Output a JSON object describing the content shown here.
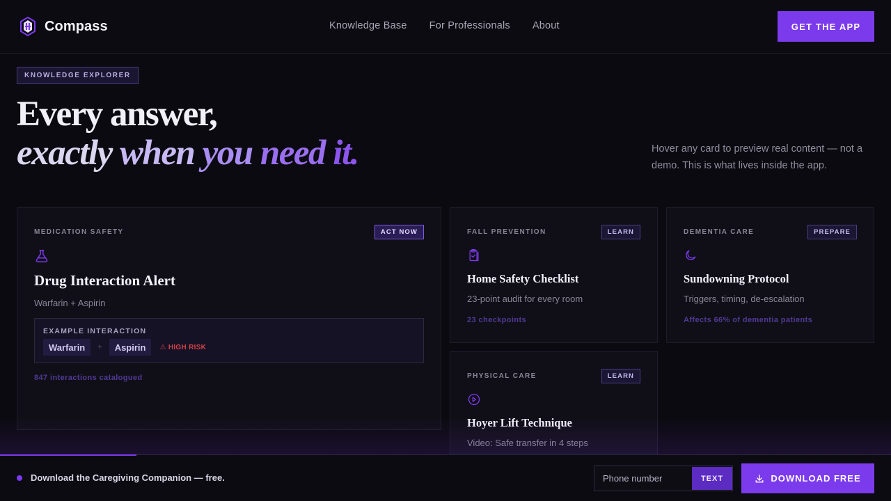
{
  "header": {
    "logo_text": "Compass",
    "nav": [
      "Knowledge Base",
      "For Professionals",
      "About"
    ],
    "cta_label": "GET THE APP"
  },
  "hero": {
    "badge": "KNOWLEDGE EXPLORER",
    "title_line1": "Every answer,",
    "title_line2_words": [
      "exactly",
      "when",
      "you",
      "need",
      "it."
    ],
    "description": "Hover any card to preview real content — not a demo. This is what lives inside the app."
  },
  "cards": [
    {
      "category": "MEDICATION SAFETY",
      "tag": "ACT NOW",
      "icon": "flask-icon",
      "title": "Drug Interaction Alert",
      "subtitle": "Warfarin + Aspirin",
      "example": {
        "label": "EXAMPLE INTERACTION",
        "drug_a": "Warfarin",
        "plus": "+",
        "drug_b": "Aspirin",
        "risk": "⚠ HIGH RISK"
      },
      "footer": "847 interactions catalogued"
    },
    {
      "category": "FALL PREVENTION",
      "tag": "LEARN",
      "icon": "clipboard-check-icon",
      "title": "Home Safety Checklist",
      "subtitle": "23-point audit for every room",
      "footer": "23 checkpoints"
    },
    {
      "category": "DEMENTIA CARE",
      "tag": "PREPARE",
      "icon": "moon-icon",
      "title": "Sundowning Protocol",
      "subtitle": "Triggers, timing, de-escalation",
      "footer": "Affects 66% of dementia patients"
    },
    {
      "category": "PHYSICAL CARE",
      "tag": "LEARN",
      "icon": "play-circle-icon",
      "title": "Hoyer Lift Technique",
      "subtitle": "Video: Safe transfer in 4 steps"
    }
  ],
  "bottom_bar": {
    "progress": 0.153,
    "message": "Download the Caregiving Companion — free.",
    "phone_placeholder": "Phone number",
    "text_button": "TEXT",
    "download_button": "DOWNLOAD FREE"
  },
  "colors": {
    "accent": "#7c3aed",
    "background": "#0b0a10",
    "risk": "#d4424a"
  }
}
